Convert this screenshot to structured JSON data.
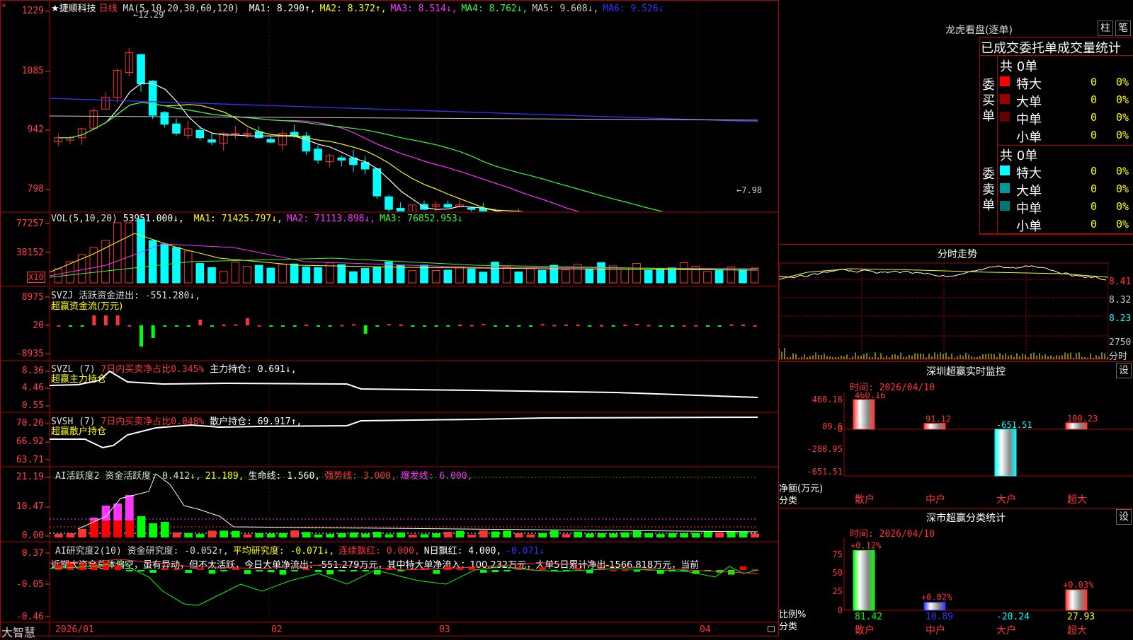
{
  "stock": {
    "name": "★捷顺科技",
    "period": "日线",
    "logo_mark": "¤"
  },
  "ma_header": {
    "label": "MA(5,10,20,30,60,120)",
    "items": [
      {
        "text": "MA1: 8.290↑,",
        "color": "#ffffff"
      },
      {
        "text": "MA2: 8.372↑,",
        "color": "#ffff00"
      },
      {
        "text": "MA3: 8.514↓,",
        "color": "#ff33ff"
      },
      {
        "text": "MA4: 8.762↓,",
        "color": "#33ff33"
      },
      {
        "text": "MA5: 9.608↓,",
        "color": "#cccccc"
      },
      {
        "text": "MA6: 9.526↓",
        "color": "#3333ff"
      }
    ]
  },
  "price_axis": [
    "1229",
    "1085",
    "942",
    "798"
  ],
  "price_marks": {
    "high": "12.29",
    "low": "7.98"
  },
  "vol_header": {
    "label": "VOL(5,10,20)",
    "value": "53951.000↓,",
    "items": [
      {
        "text": "MA1: 71425.797↓,",
        "color": "#ffff00"
      },
      {
        "text": "MA2: 71113.898↓,",
        "color": "#ff33ff"
      },
      {
        "text": "MA3: 76852.953↓",
        "color": "#33ff33"
      }
    ]
  },
  "vol_axis": [
    "77257",
    "38152"
  ],
  "vol_unit": "X10",
  "svzj": {
    "header": "SVZJ  活跃资金进出: -551.280↓,",
    "title": "超赢资金流(万元)",
    "axis": [
      "8975",
      "20",
      "-8935"
    ]
  },
  "svzl": {
    "header_a": "SVZL (7)",
    "header_b": "7日内买卖净占比0.345%",
    "header_c": "主力持仓: 0.691↓,",
    "title": "超赢主力持仓",
    "axis": [
      "8.36",
      "4.46",
      "0.55"
    ]
  },
  "svsh": {
    "header_a": "SVSH (7)",
    "header_b": "7日内买卖净占比0.048%",
    "header_c": "散户持仓: 69.917↑,",
    "title": "超赢散户持仓",
    "axis": [
      "70.26",
      "66.92",
      "63.71"
    ]
  },
  "ai_active": {
    "items": [
      {
        "text": "AI活跃度2 资金活跃度: 0.412↓,",
        "color": "#dddddd"
      },
      {
        "text": "21.189,",
        "color": "#ffff00"
      },
      {
        "text": "生命线: 1.560,",
        "color": "#ffffff"
      },
      {
        "text": "强势线: 3.000,",
        "color": "#ff3333"
      },
      {
        "text": "爆发线: 6.000,",
        "color": "#ff33ff"
      }
    ],
    "axis": [
      "21.19",
      "10.47",
      "0.00"
    ]
  },
  "ai_research": {
    "items": [
      {
        "text": "AI研究度2(10) 资金研究度: -0.052↑,",
        "color": "#dddddd"
      },
      {
        "text": "平均研究度: -0.071↓,",
        "color": "#ffff00"
      },
      {
        "text": "连续飘红: 0.000,",
        "color": "#ff3333"
      },
      {
        "text": "N日飘红: 4.000,",
        "color": "#ffffff"
      },
      {
        "text": "-0.071↓",
        "color": "#3333ff"
      }
    ],
    "comment": "近期大资金总体偏空，虽有异动，但不太活跃，今日大单净流出：-551.279万元，其中特大单净流入：100.232万元，大单5日累计净出-1566.818万元，当前",
    "axis": [
      "0.37",
      "-0.05",
      "-0.46"
    ]
  },
  "date_axis": [
    "2026/01",
    "02",
    "03",
    "04"
  ],
  "bottom_left": "大智慧",
  "right": {
    "lhb_title": "龙虎看盘(逐单)",
    "btn_zhu": "柱",
    "btn_bi": "笔",
    "stats_title": "已成交委托单成交量统计",
    "buy": {
      "side": "委买单",
      "total": "共 0单",
      "rows": [
        {
          "label": "特大",
          "value": "0",
          "pct": "0%",
          "color": "#ff0000"
        },
        {
          "label": "大单",
          "value": "0",
          "pct": "0%",
          "color": "#990000"
        },
        {
          "label": "中单",
          "value": "0",
          "pct": "0%",
          "color": "#660000"
        },
        {
          "label": "小单",
          "value": "0",
          "pct": "0%",
          "color": ""
        }
      ]
    },
    "sell": {
      "side": "委卖单",
      "total": "共 0单",
      "rows": [
        {
          "label": "特大",
          "value": "0",
          "pct": "0%",
          "color": "#00ffff"
        },
        {
          "label": "大单",
          "value": "0",
          "pct": "0%",
          "color": "#009999"
        },
        {
          "label": "中单",
          "value": "0",
          "pct": "0%",
          "color": "#007777"
        },
        {
          "label": "小单",
          "value": "0",
          "pct": "0%",
          "color": ""
        }
      ]
    },
    "intraday": {
      "title": "分时走势",
      "axis": [
        "8.41",
        "8.32",
        "8.23"
      ],
      "vol_label": "2750",
      "vol_unit": "分时"
    },
    "sz_monitor": {
      "title": "深圳超赢实时监控",
      "set": "设",
      "time": "时间: 2026/04/10",
      "axis": [
        "460.16",
        "89.6",
        "0",
        "-280.95",
        "-651.51"
      ],
      "ylabel": "净额(万元)",
      "xlabel": "分类",
      "categories": [
        "散户",
        "中户",
        "大户",
        "超大"
      ],
      "values": [
        "460.16",
        "91.12",
        "-651.51",
        "100.23"
      ]
    },
    "sz_class": {
      "title": "深市超赢分类统计",
      "set": "设",
      "time": "时间: 2026/04/10",
      "axis": [
        "75",
        "50",
        "25",
        "0"
      ],
      "ylabel": "比例%",
      "xlabel": "分类",
      "categories": [
        "散户",
        "中户",
        "大户",
        "超大"
      ],
      "pct_labels": [
        "+0.12%",
        "+0.02%",
        "",
        "+0.03%"
      ],
      "values": [
        "81.42",
        "10.89",
        "-20.24",
        "27.93"
      ]
    }
  },
  "colors": {
    "up": "#ff3333",
    "down": "#00ffff",
    "grid": "#b00000",
    "accent_yellow": "#ffff00"
  }
}
